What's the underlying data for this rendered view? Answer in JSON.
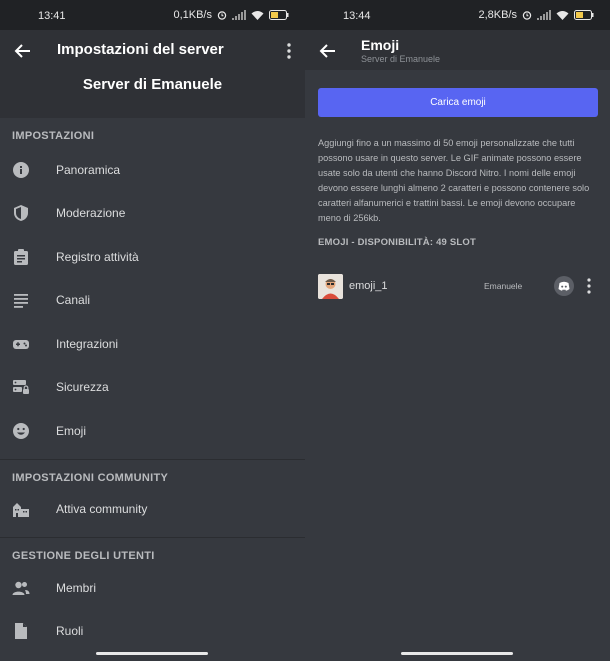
{
  "left_screen": {
    "status": {
      "time": "13:41",
      "speed": "0,1KB/s"
    },
    "header": {
      "title": "Impostazioni del server",
      "server_name": "Server di Emanuele"
    },
    "sections": [
      {
        "title": "IMPOSTAZIONI",
        "items": [
          {
            "label": "Panoramica",
            "icon": "info-icon"
          },
          {
            "label": "Moderazione",
            "icon": "shield-icon"
          },
          {
            "label": "Registro attività",
            "icon": "clipboard-icon"
          },
          {
            "label": "Canali",
            "icon": "list-icon"
          },
          {
            "label": "Integrazioni",
            "icon": "gamepad-icon"
          },
          {
            "label": "Sicurezza",
            "icon": "server-lock-icon"
          },
          {
            "label": "Emoji",
            "icon": "smiley-icon"
          }
        ]
      },
      {
        "title": "IMPOSTAZIONI COMMUNITY",
        "items": [
          {
            "label": "Attiva community",
            "icon": "community-icon"
          }
        ]
      },
      {
        "title": "GESTIONE DEGLI UTENTI",
        "items": [
          {
            "label": "Membri",
            "icon": "members-icon"
          },
          {
            "label": "Ruoli",
            "icon": "roles-icon"
          }
        ]
      }
    ]
  },
  "right_screen": {
    "status": {
      "time": "13:44",
      "speed": "2,8KB/s"
    },
    "header": {
      "title": "Emoji",
      "subtitle": "Server di Emanuele"
    },
    "upload_button": "Carica emoji",
    "description": "Aggiungi fino a un massimo di 50 emoji personalizzate che tutti possono usare in questo server. Le GIF animate possono essere usate solo da utenti che hanno Discord Nitro. I nomi delle emoji devono essere lunghi almeno 2 caratteri e possono contenere solo caratteri alfanumerici e trattini bassi. Le emoji devono occupare meno di 256kb.",
    "slots_title": "EMOJI - DISPONIBILITÀ: 49 SLOT",
    "emojis": [
      {
        "name": "emoji_1",
        "uploader": "Emanuele"
      }
    ]
  },
  "colors": {
    "background": "#36393f",
    "header": "#2f3136",
    "status_bar": "#202225",
    "accent": "#5865f2"
  }
}
